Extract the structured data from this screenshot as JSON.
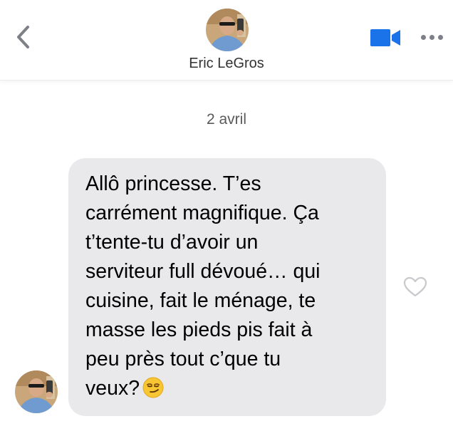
{
  "header": {
    "contact_name": "Eric LeGros",
    "back_icon": "chevron-left-icon",
    "video_icon": "video-camera-icon",
    "more_icon": "more-horizontal-icon",
    "accent_color": "#1a73e8"
  },
  "conversation": {
    "date_label": "2 avril",
    "message": {
      "lines": [
        "Allô princesse. T’es",
        "carrément magnifique. Ça",
        "t’tente-tu d’avoir un",
        "serviteur full dévoué… qui",
        "cuisine, fait le ménage, te",
        "masse les pieds pis fait à",
        "peu près tout c’que tu",
        "veux?"
      ],
      "emoji_icon": "smirking-face-emoji",
      "bubble_color": "#e9e9ec",
      "like_icon": "heart-outline-icon"
    }
  }
}
